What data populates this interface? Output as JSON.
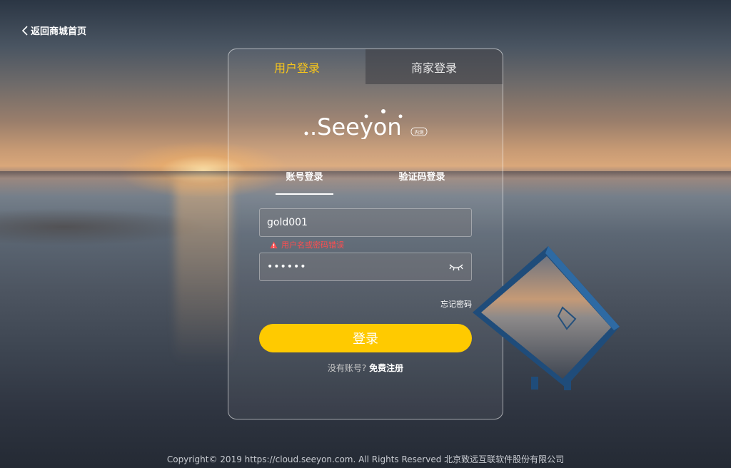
{
  "header": {
    "back_label": "返回商城首页"
  },
  "card": {
    "tabs": [
      {
        "label": "用户登录",
        "active": true
      },
      {
        "label": "商家登录",
        "active": false
      }
    ],
    "logo": {
      "text": ".Seeyon",
      "badge": "内测"
    },
    "sub_tabs": [
      {
        "label": "账号登录",
        "active": true
      },
      {
        "label": "验证码登录",
        "active": false
      }
    ],
    "username": {
      "value": "gold001"
    },
    "error": {
      "text": "用户名或密码错误"
    },
    "password": {
      "value": "••••••"
    },
    "forgot_label": "忘记密码",
    "login_label": "登录",
    "register": {
      "prompt": "没有账号?",
      "link": "免费注册"
    }
  },
  "footer": {
    "text": "Copyright© 2019 https://cloud.seeyon.com. All Rights Reserved 北京致远互联软件股份有限公司"
  },
  "colors": {
    "accent": "#ffca00",
    "active_tab": "#f8c61b",
    "error": "#ff4d4f"
  }
}
